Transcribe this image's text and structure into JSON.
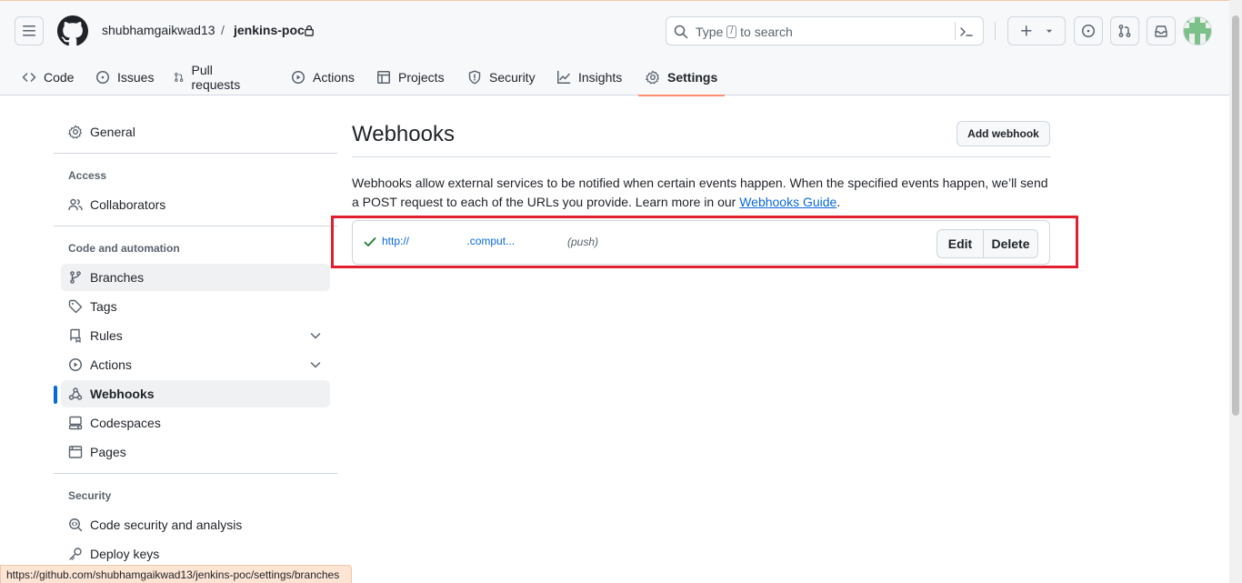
{
  "header": {
    "owner": "shubhamgaikwad13",
    "separator": "/",
    "repo": "jenkins-poc",
    "search_prefix": "Type",
    "search_key": "/",
    "search_suffix": "to search"
  },
  "tabs": [
    {
      "label": "Code",
      "icon": "code-icon"
    },
    {
      "label": "Issues",
      "icon": "issue-icon"
    },
    {
      "label": "Pull requests",
      "icon": "pull-request-icon"
    },
    {
      "label": "Actions",
      "icon": "play-icon"
    },
    {
      "label": "Projects",
      "icon": "table-icon"
    },
    {
      "label": "Security",
      "icon": "shield-icon"
    },
    {
      "label": "Insights",
      "icon": "graph-icon"
    },
    {
      "label": "Settings",
      "icon": "gear-icon",
      "active": true
    }
  ],
  "sidebar": {
    "general": "General",
    "access_heading": "Access",
    "collaborators": "Collaborators",
    "code_heading": "Code and automation",
    "branches": "Branches",
    "tags": "Tags",
    "rules": "Rules",
    "actions": "Actions",
    "webhooks": "Webhooks",
    "codespaces": "Codespaces",
    "pages": "Pages",
    "security_heading": "Security",
    "code_security": "Code security and analysis",
    "deploy_keys": "Deploy keys"
  },
  "main": {
    "title": "Webhooks",
    "add_button": "Add webhook",
    "description": "Webhooks allow external services to be notified when certain events happen. When the specified events happen, we’ll send a POST request to each of the URLs you provide. Learn more in our",
    "guide_link": "Webhooks Guide",
    "description_end": ".",
    "webhook": {
      "url": "http://                   .comput...",
      "events": "(push)",
      "status": "check-icon",
      "edit": "Edit",
      "delete": "Delete"
    }
  },
  "status_url": "https://github.com/shubhamgaikwad13/jenkins-poc/settings/branches",
  "colors": {
    "accent": "#0969da",
    "tab_underline": "#fd8c73",
    "highlight": "#e0202e",
    "success": "#1a7f37"
  }
}
